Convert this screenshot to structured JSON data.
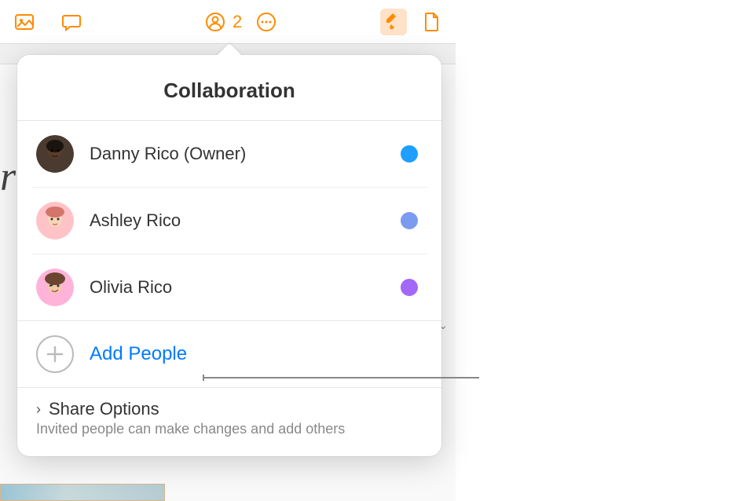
{
  "toolbar": {
    "collab_count": "2"
  },
  "popover": {
    "title": "Collaboration",
    "participants": [
      {
        "name": "Danny Rico (Owner)",
        "status_color": "#1E9FFF",
        "avatar_bg": "#3a2e28",
        "avatar_type": "memoji1"
      },
      {
        "name": "Ashley Rico",
        "status_color": "#7A9BEF",
        "avatar_bg": "#FFC2C7",
        "avatar_type": "memoji2"
      },
      {
        "name": "Olivia Rico",
        "status_color": "#A368F7",
        "avatar_bg": "#FFB3D9",
        "avatar_type": "memoji3"
      }
    ],
    "add_people_label": "Add People",
    "share_options": {
      "title": "Share Options",
      "subtitle": "Invited people can make changes and add others"
    }
  }
}
